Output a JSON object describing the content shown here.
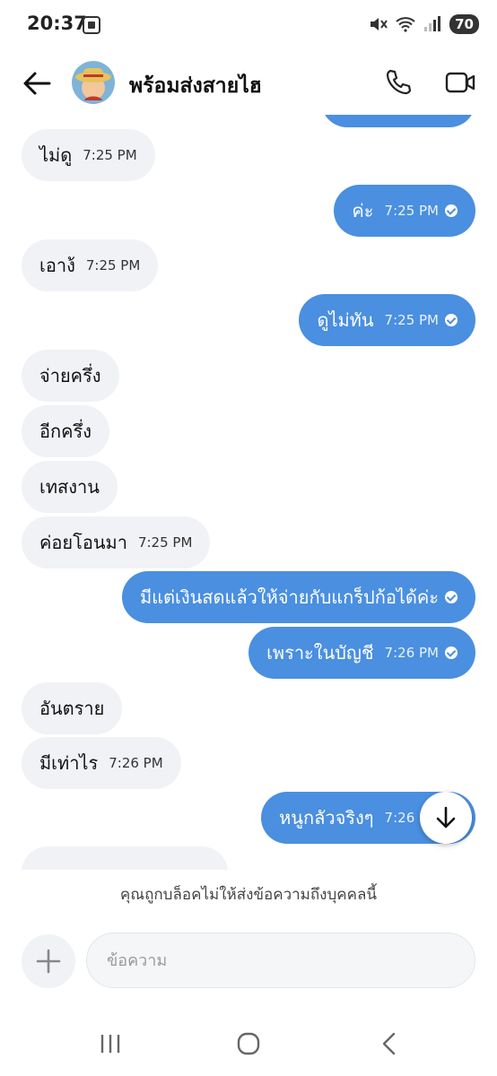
{
  "status_bar": {
    "time": "20:37",
    "battery": "70"
  },
  "header": {
    "contact_name": "พร้อมส่งสายไฮ"
  },
  "messages": [
    {
      "text": "ไม่ดู",
      "time": "7:25 PM"
    },
    {
      "text": "ค่ะ",
      "time": "7:25 PM"
    },
    {
      "text": "เอาง้",
      "time": "7:25 PM"
    },
    {
      "text": "ดูไม่ทัน",
      "time": "7:25 PM"
    },
    {
      "text": "จ่ายครึ่ง",
      "time": ""
    },
    {
      "text": "อีกครึ่ง",
      "time": ""
    },
    {
      "text": "เทสงาน",
      "time": ""
    },
    {
      "text": "ค่อยโอนมา",
      "time": "7:25 PM"
    },
    {
      "text": "มีแต่เงินสดแล้วให้จ่ายกับแกร็ปก้อได้ค่ะ",
      "time": ""
    },
    {
      "text": "เพราะในบัญชี",
      "time": "7:26 PM"
    },
    {
      "text": "อันตราย",
      "time": ""
    },
    {
      "text": "มีเท่าไร",
      "time": "7:26 PM"
    },
    {
      "text": "หนูกลัวจริงๆ",
      "time": "7:26 PM"
    }
  ],
  "blocked_notice": "คุณถูกบล็อคไม่ให้ส่งข้อความถึงบุคคลนี้",
  "composer": {
    "placeholder": "ข้อความ"
  },
  "colors": {
    "outgoing_bubble": "#4a8fe0",
    "incoming_bubble": "#f0f2f5"
  }
}
